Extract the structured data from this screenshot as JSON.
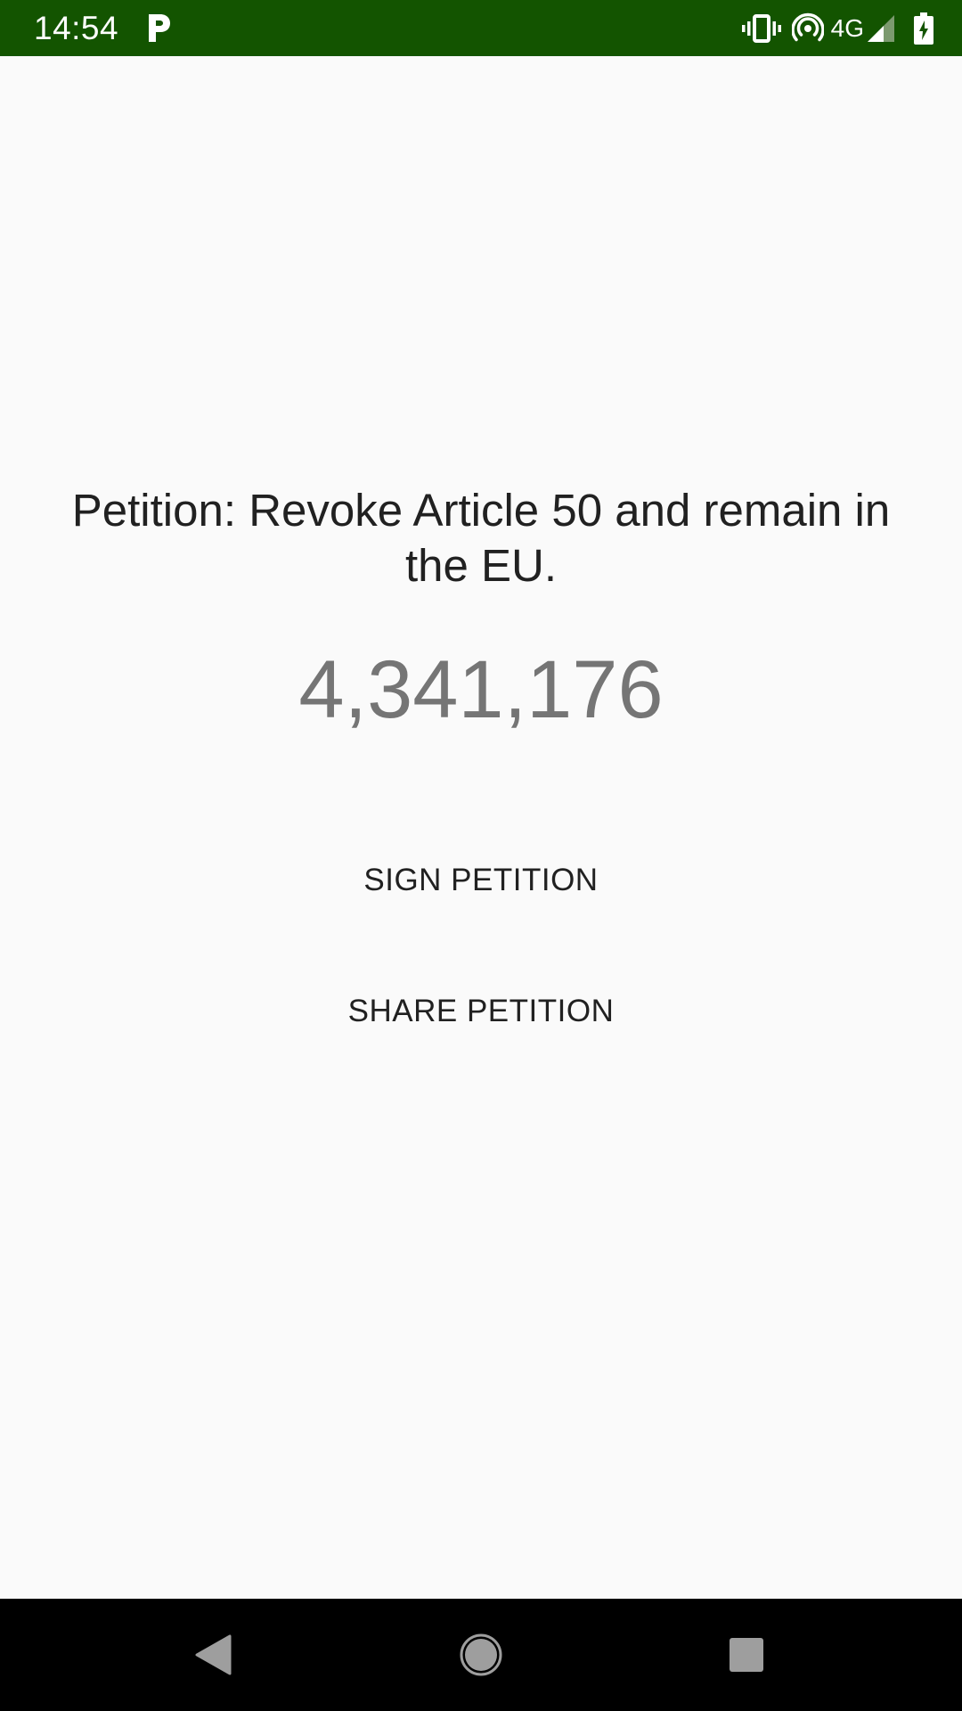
{
  "status_bar": {
    "time": "14:54",
    "network": "4G",
    "background_color": "#135400",
    "icons": [
      "parking-app-icon",
      "vibrate-icon",
      "hotspot-icon",
      "signal-icon",
      "battery-charging-icon"
    ]
  },
  "petition": {
    "title": "Petition: Revoke Article 50 and remain in the EU.",
    "signature_count": "4,341,176"
  },
  "actions": {
    "sign_label": "SIGN PETITION",
    "share_label": "SHARE PETITION"
  },
  "nav_bar": {
    "icons": [
      "back-icon",
      "home-icon",
      "recents-icon"
    ]
  }
}
